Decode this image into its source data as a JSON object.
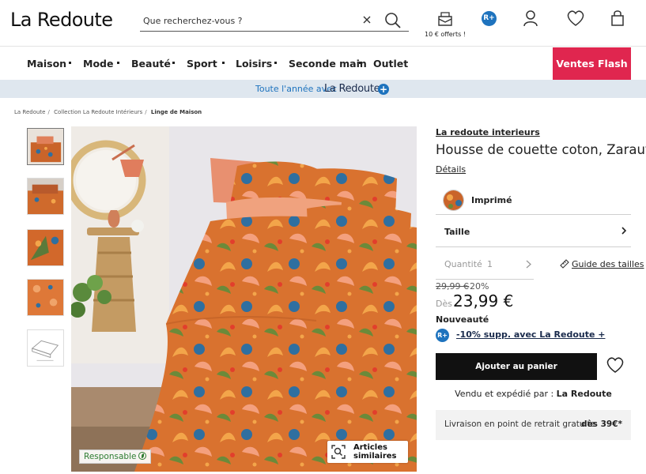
{
  "header": {
    "logo": "La Redoute",
    "search": {
      "placeholder": "Que recherchez-vous ?"
    },
    "gift_caption": "10 € offerts !",
    "rplus_badge": "R+",
    "icons": [
      "gift-icon",
      "rplus-icon",
      "user-icon",
      "heart-icon",
      "bag-icon"
    ]
  },
  "nav": {
    "items": [
      {
        "label": "Maison"
      },
      {
        "label": "Mode"
      },
      {
        "label": "Beauté"
      },
      {
        "label": "Sport"
      },
      {
        "label": "Loisirs"
      },
      {
        "label": "Seconde main"
      },
      {
        "label": "Outlet"
      }
    ],
    "flash": "Ventes Flash",
    "flash_color": "#e0264f"
  },
  "band": {
    "text": "Toute l'année avec",
    "logo": "La Redoute",
    "plus": "+"
  },
  "breadcrumb": [
    {
      "label": "La Redoute"
    },
    {
      "label": "Collection La Redoute Intérieurs"
    },
    {
      "label": "Linge de Maison"
    }
  ],
  "gallery": {
    "thumbnails": 5,
    "responsable": "Responsable",
    "similar": "Articles similaires"
  },
  "product": {
    "brand": "La redoute interieurs",
    "title": "Housse de couette coton, Zarautz",
    "details": "Détails",
    "variant": "Imprimé",
    "size_label": "Taille",
    "quantity_label": "Quantité",
    "quantity_value": "1",
    "size_guide": "Guide des tailles",
    "old_price": "29,99 €",
    "discount": "-20%",
    "from": "Dès",
    "price": "23,99 €",
    "new_label": "Nouveauté",
    "rplus_badge": "R+",
    "rplus_offer": "-10% supp. avec La Redoute +",
    "add_to_cart": "Ajouter au panier",
    "seller_prefix": "Vendu et expédié par :",
    "seller_name": "La Redoute",
    "delivery_label": "Livraison en point de retrait gratuite",
    "delivery_value": "dès 39€*"
  },
  "colors": {
    "accent": "#1e73be",
    "flash": "#e0264f",
    "duvet": "#d9722f"
  }
}
